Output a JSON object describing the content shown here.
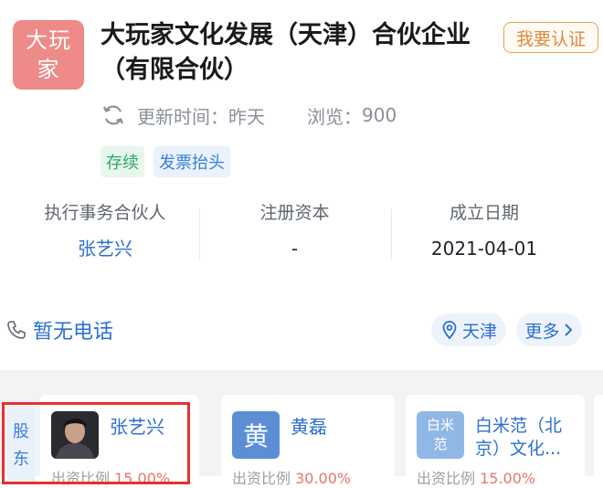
{
  "company": {
    "logo_line1": "大玩",
    "logo_line2": "家",
    "name": "大玩家文化发展（天津）合伙企业（有限合伙）",
    "claim_button": "我要认证",
    "update_label": "更新时间：",
    "update_value": "昨天",
    "views_label": "浏览：",
    "views_value": "900",
    "tags": [
      "存续",
      "发票抬头"
    ]
  },
  "info": {
    "partner_label": "执行事务合伙人",
    "partner_value": "张艺兴",
    "capital_label": "注册资本",
    "capital_value": "-",
    "date_label": "成立日期",
    "date_value": "2021-04-01"
  },
  "contact": {
    "phone_text": "暂无电话",
    "location": "天津",
    "more": "更多"
  },
  "shareholders": {
    "side_label_1": "股",
    "side_label_2": "东",
    "cards": [
      {
        "name": "张艺兴",
        "ratio_label": "出资比例",
        "ratio_value": "15.00%"
      },
      {
        "name": "黄磊",
        "avatar_text": "黄",
        "ratio_label": "出资比例",
        "ratio_value": "30.00%"
      },
      {
        "name": "白米范（北京）文化...",
        "avatar_line1": "白米",
        "avatar_line2": "范",
        "ratio_label": "出资比例",
        "ratio_value": "15.00%"
      }
    ]
  },
  "colors": {
    "accent_blue": "#2c6fcf",
    "logo_bg": "#ee8a88",
    "highlight_red": "#e8302f",
    "claim_orange": "#e08a3a"
  },
  "icons": [
    "refresh-icon",
    "phone-icon",
    "location-pin-icon",
    "chevron-right-icon"
  ]
}
